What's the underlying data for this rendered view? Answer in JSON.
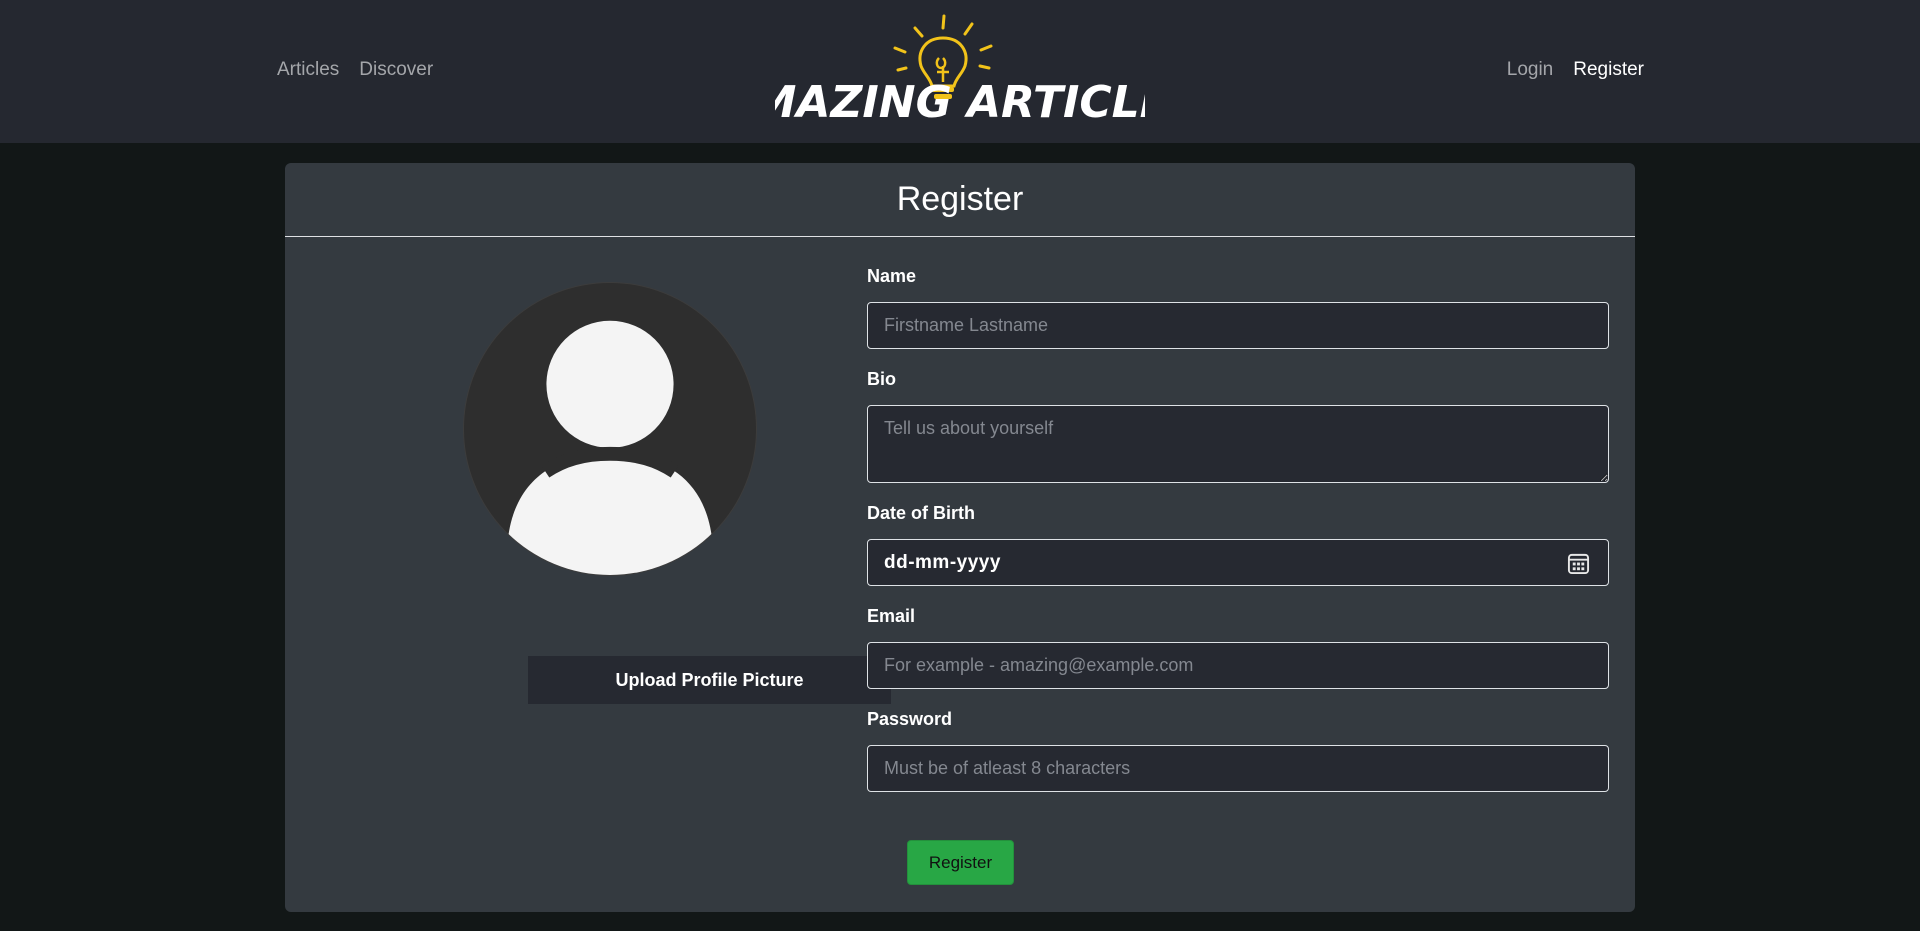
{
  "nav": {
    "left": [
      {
        "label": "Articles"
      },
      {
        "label": "Discover"
      }
    ],
    "right": [
      {
        "label": "Login"
      },
      {
        "label": "Register"
      }
    ],
    "brand": "AMAZING ARTICLES"
  },
  "card": {
    "title": "Register"
  },
  "avatar": {
    "upload_label": "Upload Profile Picture"
  },
  "form": {
    "name_label": "Name",
    "name_placeholder": "Firstname Lastname",
    "bio_label": "Bio",
    "bio_placeholder": "Tell us about yourself",
    "dob_label": "Date of Birth",
    "dob_value": "dd-mm-yyyy",
    "email_label": "Email",
    "email_placeholder": "For example - amazing@example.com",
    "password_label": "Password",
    "password_placeholder": "Must be of atleast 8 characters",
    "submit_label": "Register"
  },
  "colors": {
    "accent_green": "#28a745",
    "navbar_bg": "#252830",
    "card_bg": "#343a40",
    "logo_yellow": "#f2c31a"
  }
}
